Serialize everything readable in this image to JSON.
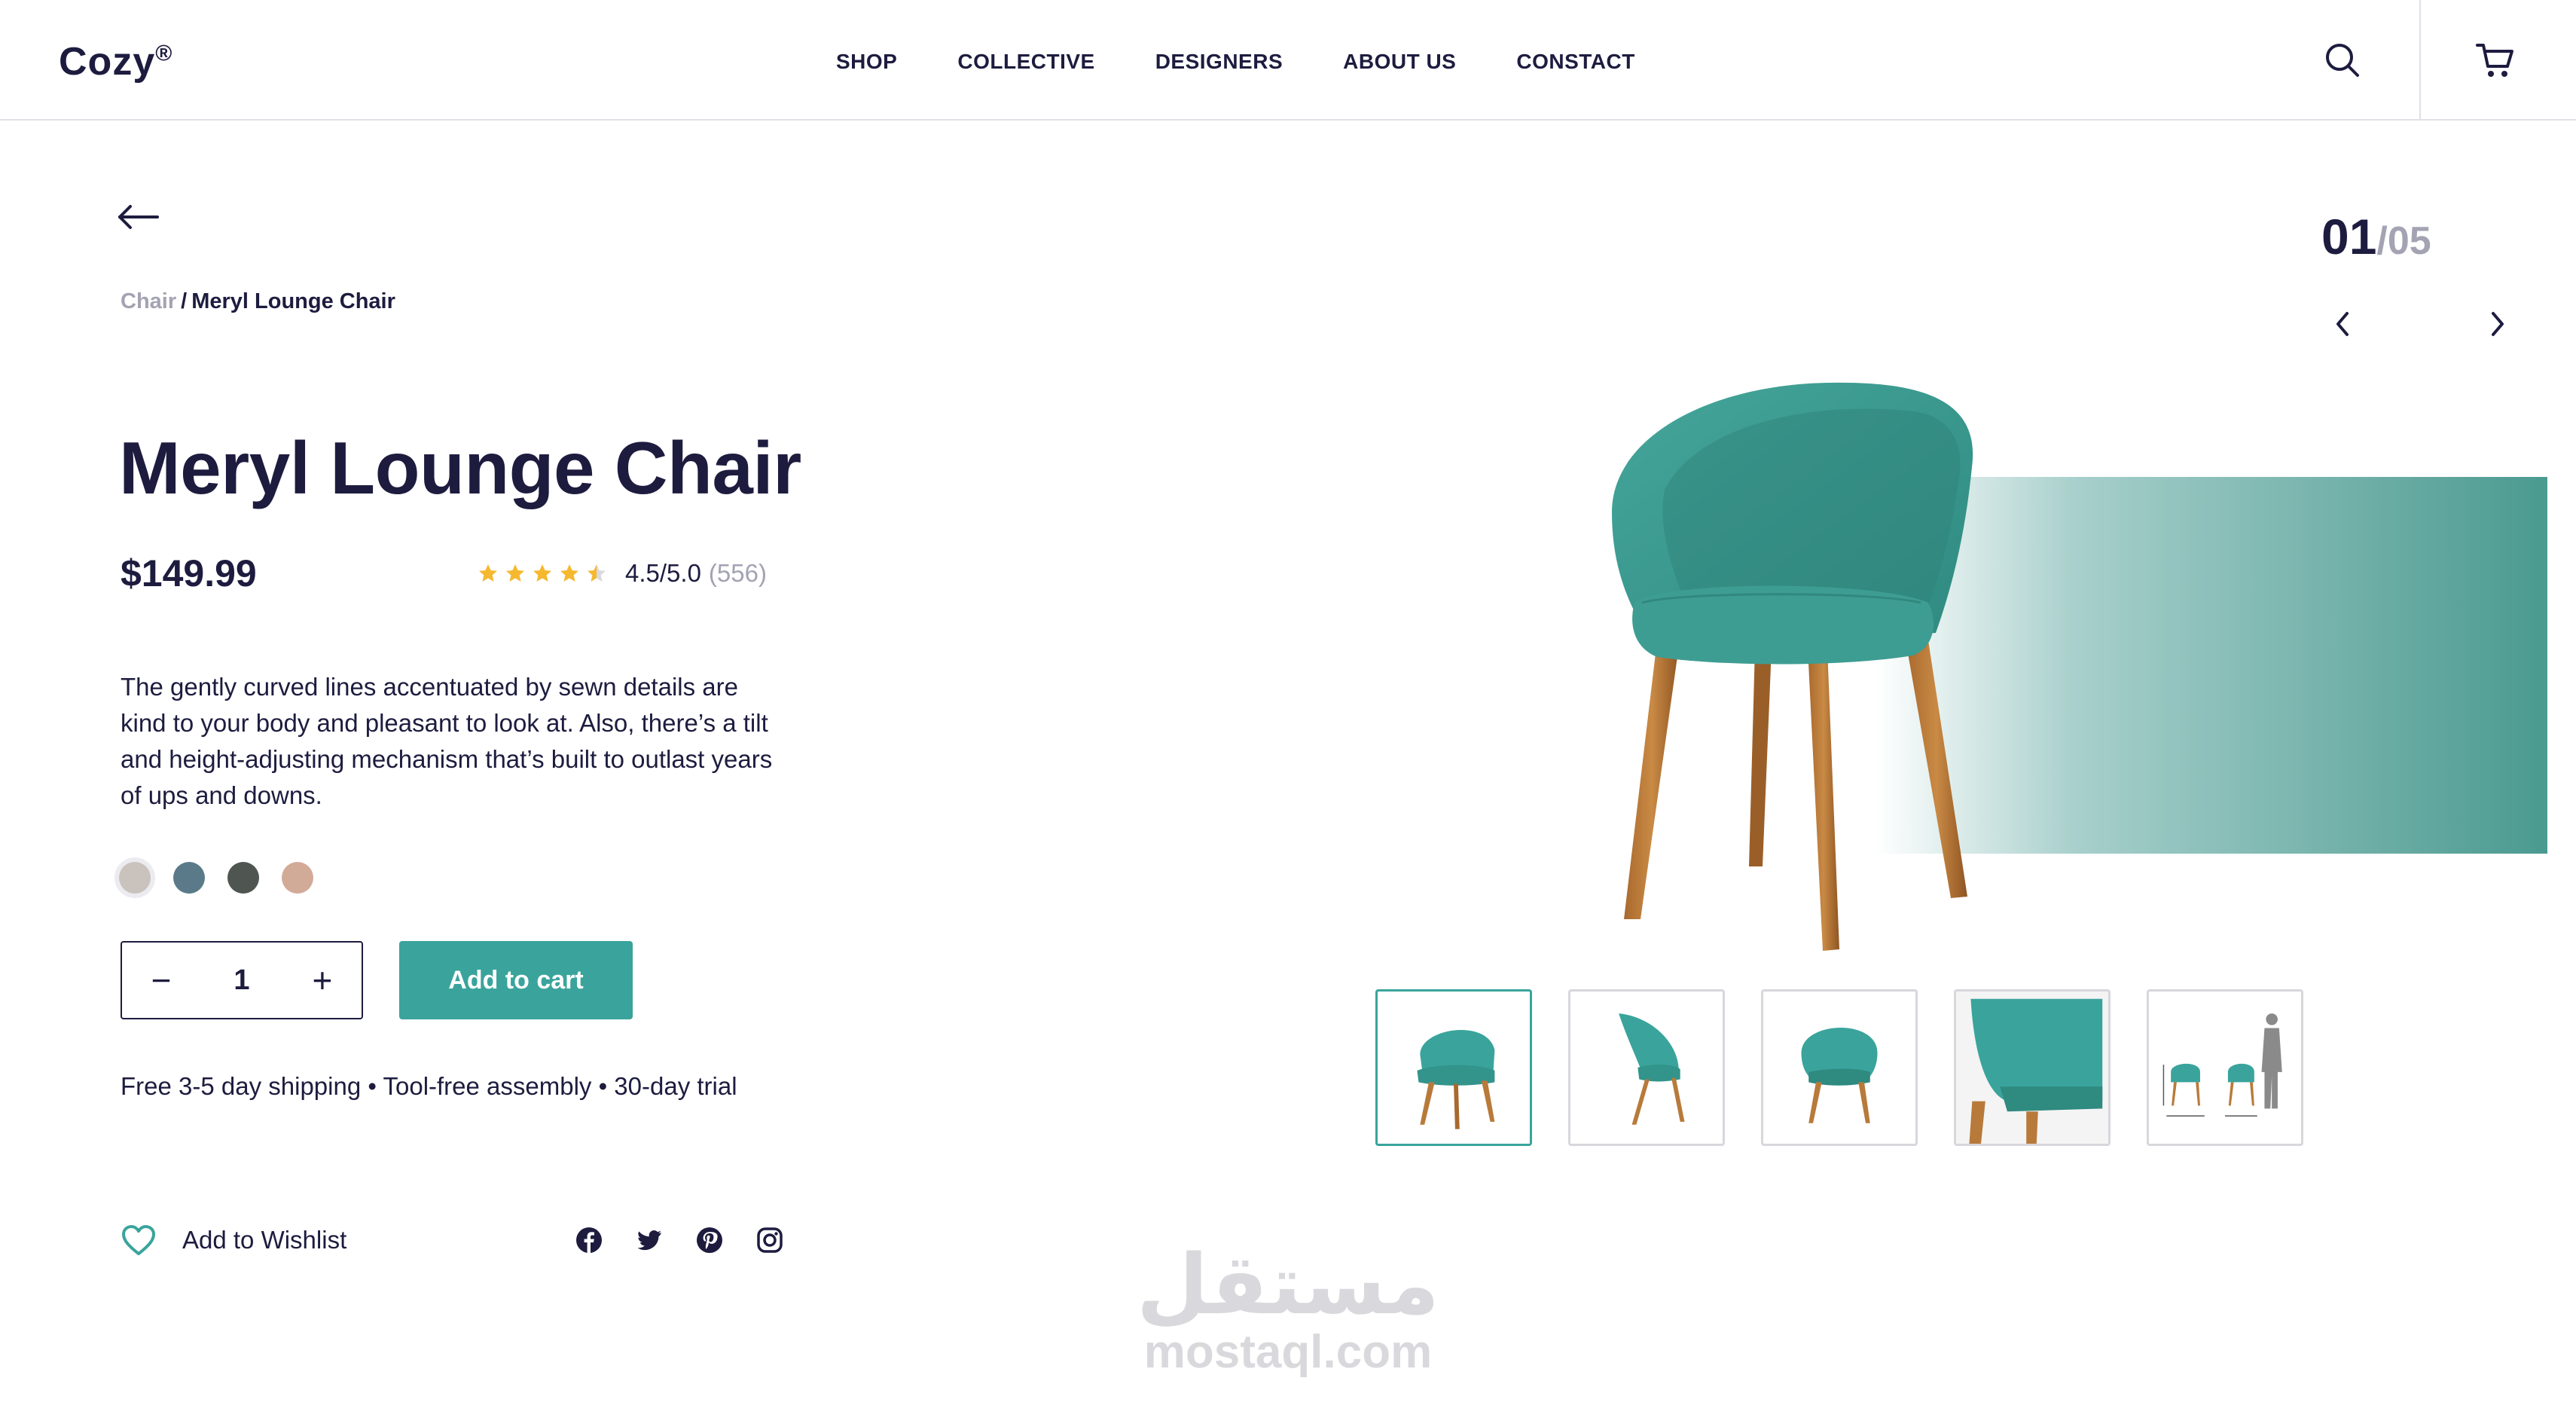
{
  "brand": {
    "name": "Cozy",
    "mark": "®"
  },
  "nav": [
    "SHOP",
    "COLLECTIVE",
    "DESIGNERS",
    "ABOUT US",
    "CONSTACT"
  ],
  "breadcrumb": {
    "parent": "Chair",
    "separator": "/",
    "current": "Meryl Lounge Chair"
  },
  "product": {
    "title": "Meryl Lounge Chair",
    "price": "$149.99",
    "rating": {
      "value": 4.5,
      "score_text": "4.5/5.0",
      "count_text": "(556)"
    },
    "description": "The gently curved lines accentuated by sewn details are kind to your body and pleasant to look at. Also, there’s a tilt and height-adjusting mechanism that’s built to outlast years of ups and downs.",
    "swatches": [
      "#c9c2bd",
      "#5b7a89",
      "#4f5550",
      "#d2aa98"
    ],
    "selected_swatch": 0,
    "quantity": "1",
    "add_to_cart": "Add to cart",
    "shipping": "Free 3-5 day shipping • Tool-free assembly • 30-day trial",
    "wishlist": "Add to Wishlist"
  },
  "gallery": {
    "current": "01",
    "total": "/05"
  },
  "socials": [
    "facebook-icon",
    "twitter-icon",
    "pinterest-icon",
    "instagram-icon"
  ],
  "colors": {
    "accent": "#3aa49c",
    "text": "#1d1c3f",
    "muted": "#a3a3b3",
    "star": "#f5b82e"
  },
  "watermark": {
    "arabic": "مستقل",
    "latin": "mostaql.com"
  }
}
